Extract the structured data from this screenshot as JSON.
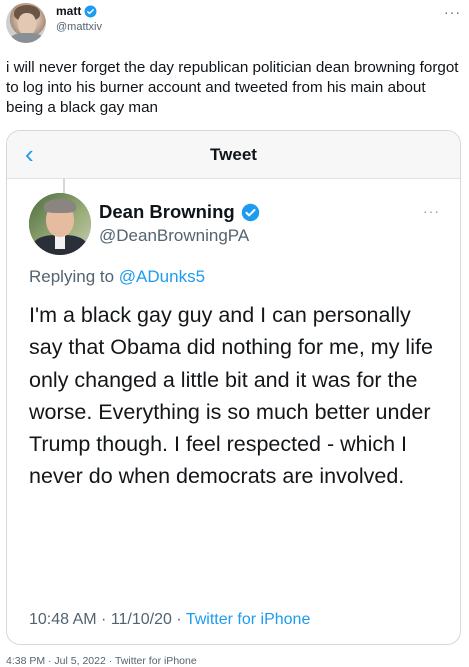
{
  "outer_tweet": {
    "author_name": "matt",
    "author_handle": "@mattxiv",
    "more_label": "···",
    "text": "i will never forget the day republican politician dean browning forgot to log into his burner account and tweeted from his main about being a black gay man",
    "timestamp": "4:38 PM · Jul 5, 2022",
    "separator": " · ",
    "source": "Twitter for iPhone"
  },
  "screenshot": {
    "title": "Tweet",
    "back_label": "<",
    "author_name": "Dean Browning",
    "author_handle": "@DeanBrowningPA",
    "more_label": "···",
    "replying_prefix": "Replying to ",
    "replying_to": "@ADunks5",
    "text": "I'm a black gay guy and I can personally say that Obama did nothing for me, my life only changed a little bit and it was for the worse. Everything is so much better under Trump though. I feel respected - which I never do when democrats are involved.",
    "timestamp": "10:48 AM · 11/10/20 · ",
    "source": "Twitter for iPhone"
  },
  "colors": {
    "accent": "#1d9bf0",
    "secondary_text": "#536471",
    "border": "#cfd9de"
  },
  "icons": {
    "verified": "verified-badge-icon",
    "back": "chevron-left-icon",
    "more": "more-dots-icon"
  }
}
